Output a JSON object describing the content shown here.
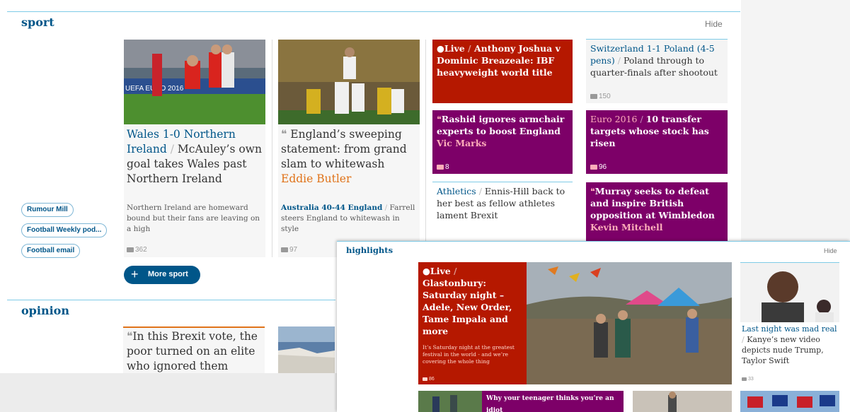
{
  "sport": {
    "title": "sport",
    "hide": "Hide",
    "pills": [
      "Rumour Mill",
      "Football Weekly pod...",
      "Football email"
    ],
    "more_button": "More sport",
    "card1": {
      "kicker": "Wales 1-0 Northern Ireland",
      "headline": "McAuley’s own goal takes Wales past Northern Ireland",
      "trail": "Northern Ireland are homeward bound but their fans are leaving on a high",
      "comments": "362"
    },
    "card2": {
      "quote_mark": "❝",
      "headline": "England’s sweeping statement: from grand slam to whitewash",
      "byline": "Eddie Butler",
      "trail_kicker": "Australia 40-44 England",
      "trail": "Farrell steers England to whitewash in style",
      "comments": "97"
    },
    "tiles": {
      "joshua": {
        "kicker": "Live",
        "headline": "Anthony Joshua v Dominic Breazeale: IBF heavyweight world title"
      },
      "rashid": {
        "headline": "Rashid ignores armchair experts to boost England",
        "byline": "Vic Marks",
        "comments": "8"
      },
      "athletics": {
        "kicker": "Athletics",
        "headline": "Ennis-Hill back to her best as fellow athletes lament Brexit"
      },
      "swiss": {
        "kicker": "Switzerland 1-1 Poland (4-5 pens)",
        "headline": "Poland through to quarter-finals after shootout",
        "comments": "150"
      },
      "euro": {
        "kicker": "Euro 2016",
        "headline": "10 transfer targets whose stock has risen",
        "comments": "96"
      },
      "murray": {
        "headline": "Murray seeks to defeat and inspire British opposition at Wimbledon",
        "byline": "Kevin Mitchell"
      }
    }
  },
  "opinion": {
    "title": "opinion",
    "card1": {
      "headline": "In this Brexit vote, the poor turned on an elite who ignored them"
    }
  },
  "highlights": {
    "title": "highlights",
    "hide": "Hide",
    "glastonbury": {
      "kicker": "Live",
      "headline": "Glastonbury: Saturday night – Adele, New Order, Tame Impala and more",
      "trail": "It’s Saturday night at the greatest festival in the world - and we’re covering the whole thing",
      "comments": "86"
    },
    "kanye": {
      "kicker": "Last night was mad real",
      "headline": "Kanye’s new video depicts nude Trump, Taylor Swift",
      "comments": "33"
    },
    "teen": {
      "headline": "Why your teenager thinks you’re an idiot"
    }
  }
}
